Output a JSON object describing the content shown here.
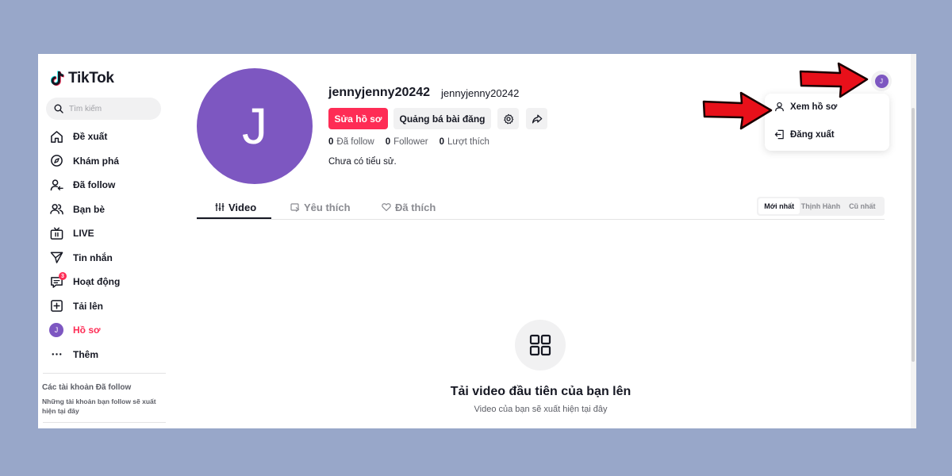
{
  "app": {
    "name": "TikTok"
  },
  "search": {
    "placeholder": "Tìm kiếm"
  },
  "sidebar": {
    "items": [
      {
        "label": "Đề xuất",
        "icon": "home-icon"
      },
      {
        "label": "Khám phá",
        "icon": "compass-icon"
      },
      {
        "label": "Đã follow",
        "icon": "following-icon"
      },
      {
        "label": "Bạn bè",
        "icon": "friends-icon"
      },
      {
        "label": "LIVE",
        "icon": "live-icon"
      },
      {
        "label": "Tin nhắn",
        "icon": "send-icon"
      },
      {
        "label": "Hoạt động",
        "icon": "activity-icon",
        "badge": "3"
      },
      {
        "label": "Tải lên",
        "icon": "upload-icon"
      },
      {
        "label": "Hồ sơ",
        "icon": "avatar",
        "avatar_letter": "J"
      },
      {
        "label": "Thêm",
        "icon": "more-icon"
      }
    ],
    "following_title": "Các tài khoản Đã follow",
    "following_desc": "Những tài khoản bạn follow sẽ xuất hiện tại đây"
  },
  "profile": {
    "avatar_letter": "J",
    "username": "jennyjenny20242",
    "nickname": "jennyjenny20242",
    "edit_button": "Sửa hồ sơ",
    "promote_button": "Quảng bá bài đăng",
    "stats": [
      {
        "value": "0",
        "label": "Đã follow"
      },
      {
        "value": "0",
        "label": "Follower"
      },
      {
        "value": "0",
        "label": "Lượt thích"
      }
    ],
    "bio": "Chưa có tiểu sử."
  },
  "tabs": [
    {
      "label": "Video",
      "active": true
    },
    {
      "label": "Yêu thích",
      "active": false
    },
    {
      "label": "Đã thích",
      "active": false
    }
  ],
  "sort": {
    "options": [
      "Mới nhất",
      "Thịnh Hành",
      "Cũ nhất"
    ],
    "selected": "Mới nhất"
  },
  "empty_state": {
    "title": "Tải video đầu tiên của bạn lên",
    "subtitle": "Video của bạn sẽ xuất hiện tại đây"
  },
  "header": {
    "avatar_letter": "J"
  },
  "dropdown": {
    "items": [
      {
        "label": "Xem hồ sơ",
        "icon": "user-icon"
      },
      {
        "label": "Đăng xuất",
        "icon": "logout-icon"
      }
    ]
  },
  "colors": {
    "accent": "#fe2c55",
    "avatar": "#7d57c1",
    "background": "#98a7c9",
    "annotation_arrow": "#e8101a"
  }
}
